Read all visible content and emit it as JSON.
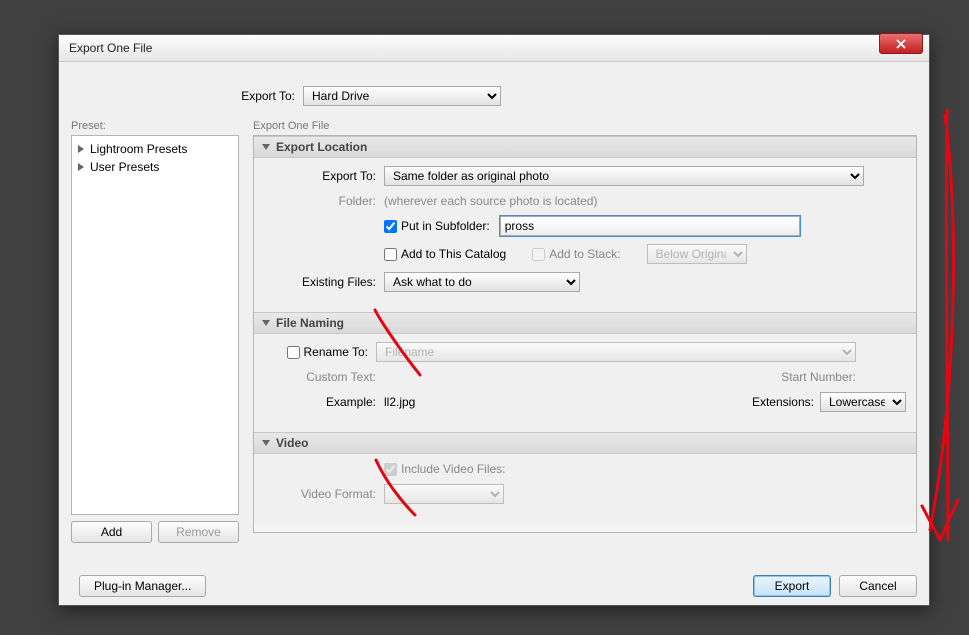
{
  "titlebar": {
    "title": "Export One File"
  },
  "top": {
    "export_to_label": "Export To:",
    "export_to_value": "Hard Drive"
  },
  "presets": {
    "label": "Preset:",
    "items": [
      "Lightroom Presets",
      "User Presets"
    ],
    "add_label": "Add",
    "remove_label": "Remove"
  },
  "right_label": "Export One File",
  "export_location": {
    "title": "Export Location",
    "export_to_label": "Export To:",
    "export_to_value": "Same folder as original photo",
    "folder_label": "Folder:",
    "folder_value": "(wherever each source photo is located)",
    "put_in_subfolder_label": "Put in Subfolder:",
    "subfolder_value": "pross",
    "add_to_catalog_label": "Add to This Catalog",
    "add_to_stack_label": "Add to Stack:",
    "stack_position": "Below Original",
    "existing_files_label": "Existing Files:",
    "existing_files_value": "Ask what to do"
  },
  "file_naming": {
    "title": "File Naming",
    "rename_to_label": "Rename To:",
    "rename_to_value": "Filename",
    "custom_text_label": "Custom Text:",
    "start_number_label": "Start Number:",
    "example_label": "Example:",
    "example_value": "ll2.jpg",
    "extensions_label": "Extensions:",
    "extensions_value": "Lowercase"
  },
  "video": {
    "title": "Video",
    "include_label": "Include Video Files:",
    "video_format_label": "Video Format:"
  },
  "footer": {
    "plugin_manager": "Plug-in Manager...",
    "export": "Export",
    "cancel": "Cancel"
  }
}
